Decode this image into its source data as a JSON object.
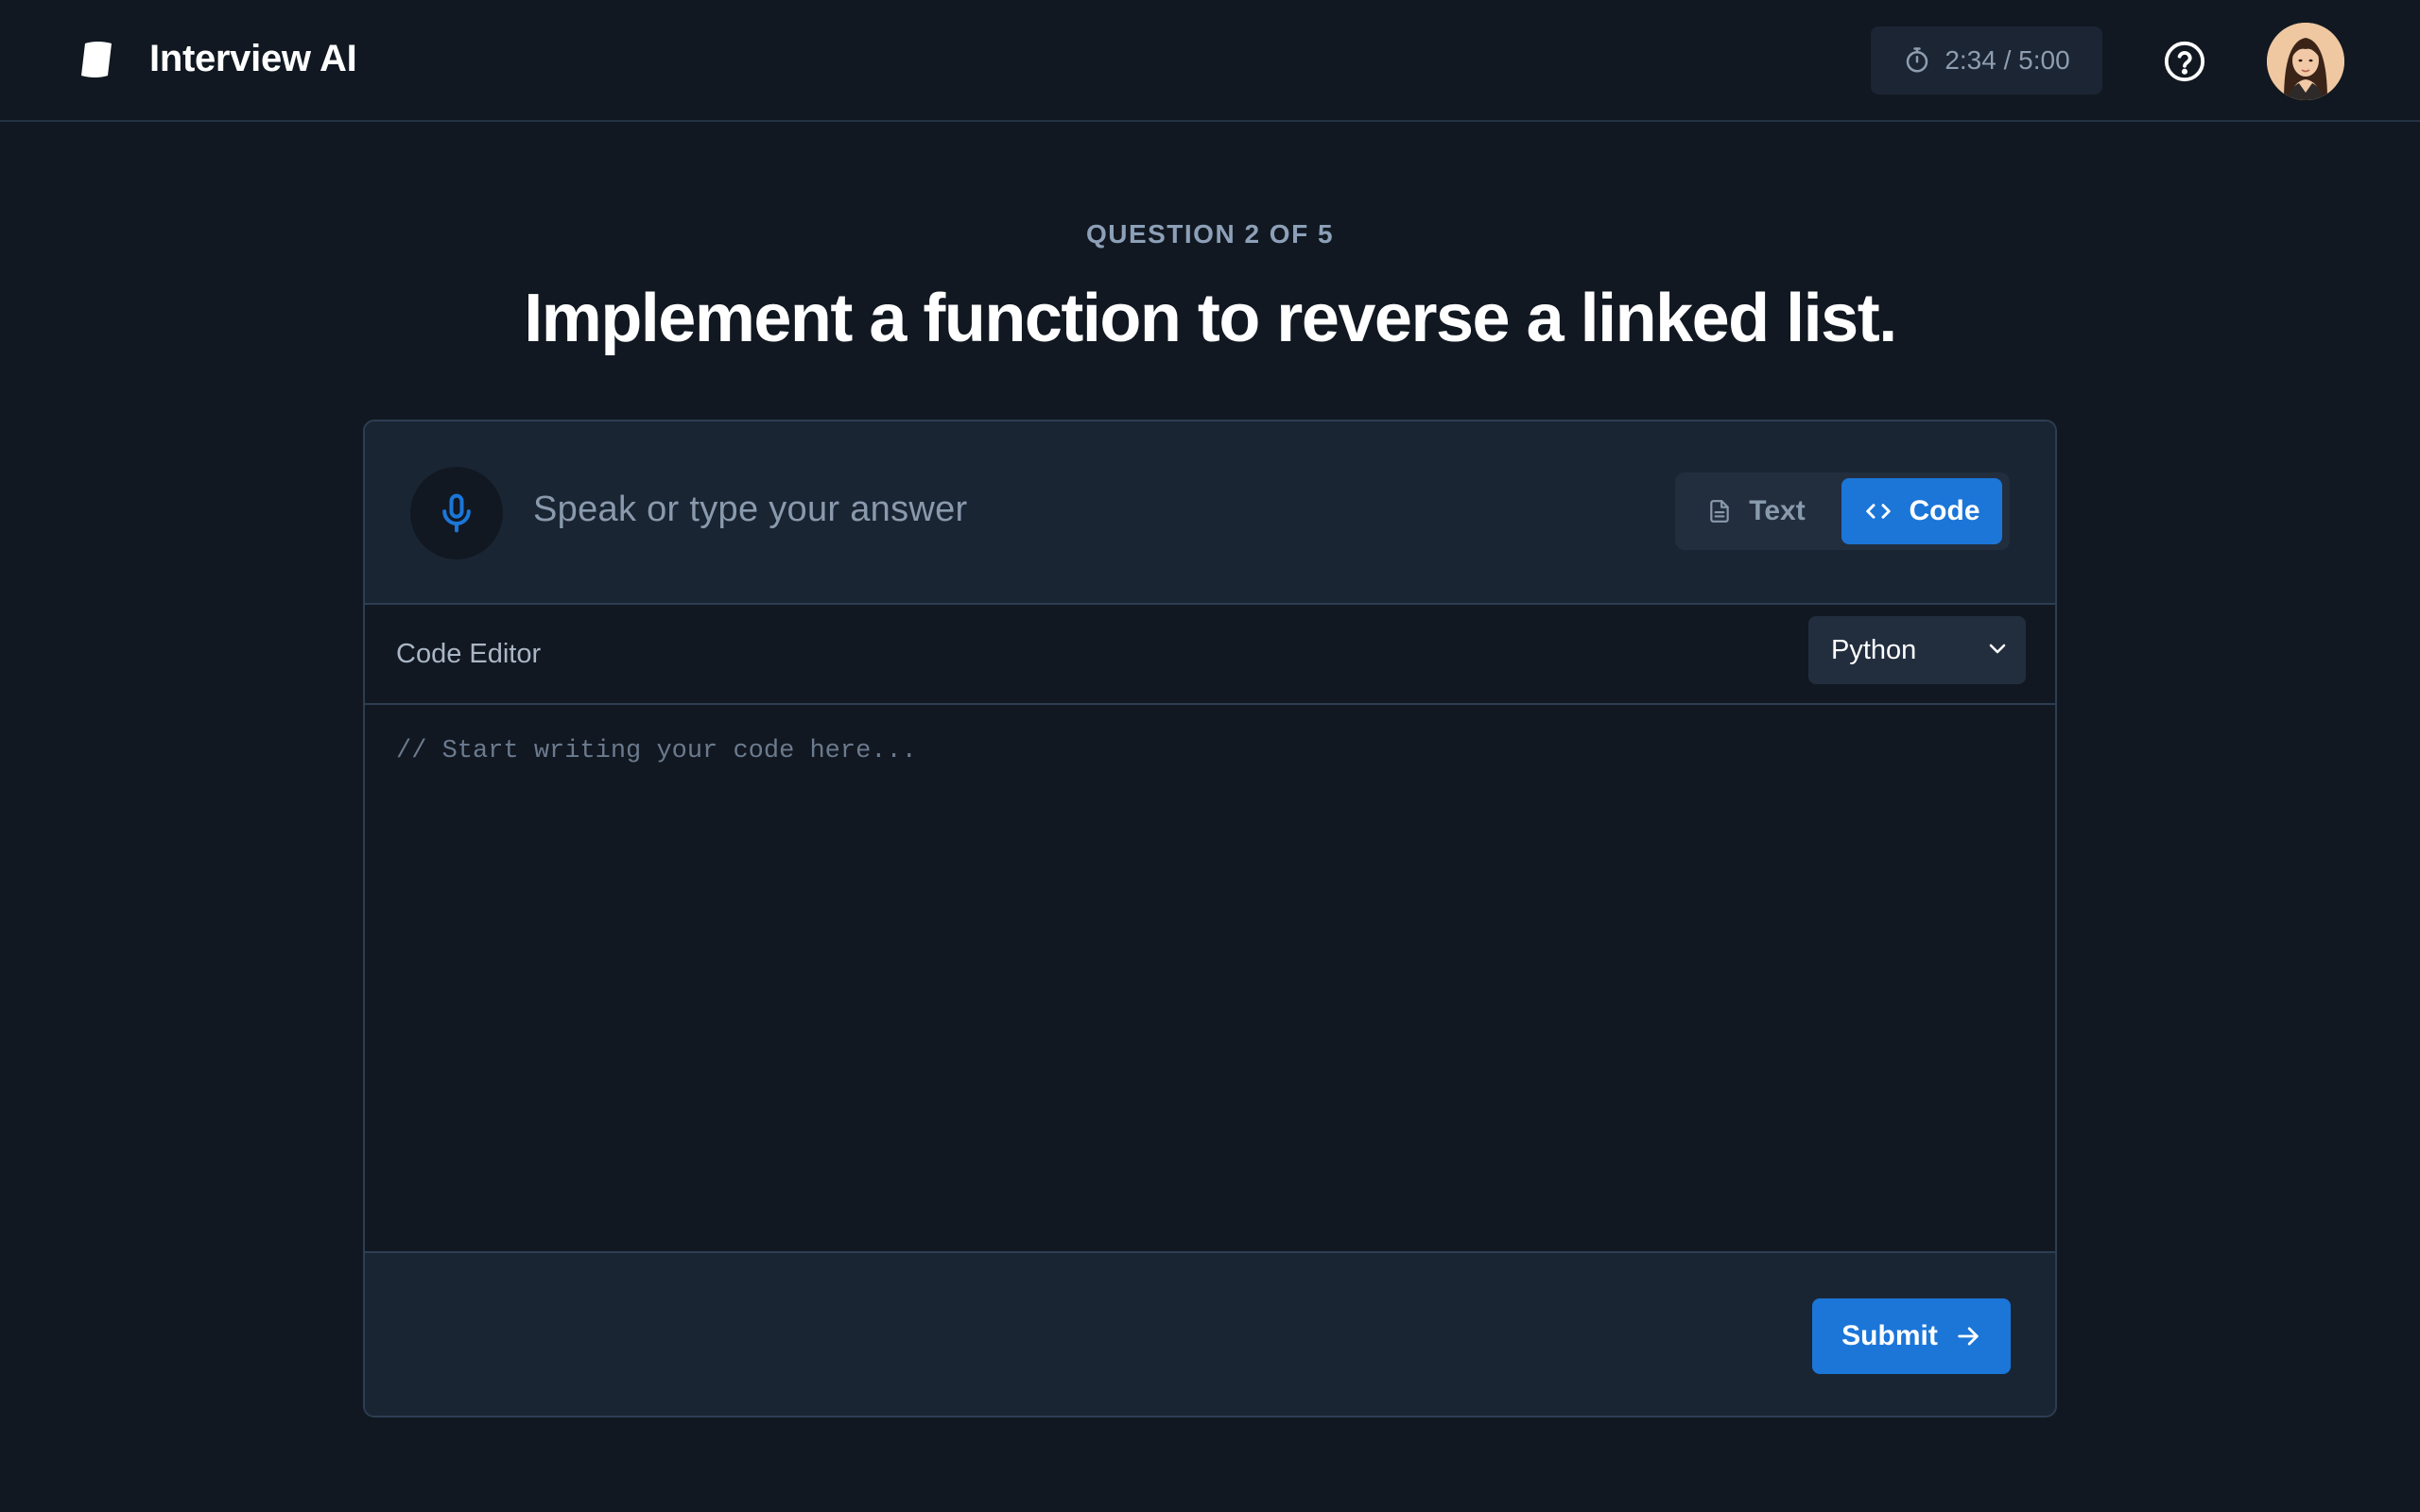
{
  "header": {
    "app_name": "Interview AI",
    "timer": "2:34 / 5:00",
    "icons": {
      "logo": "brand-logo-icon",
      "timer": "stopwatch-icon",
      "help": "help-circle-icon"
    }
  },
  "question": {
    "counter": "QUESTION 2 OF 5",
    "title": "Implement a function to reverse a linked list."
  },
  "answer": {
    "placeholder": "Speak or type your answer",
    "mic_icon": "microphone-icon",
    "modes": [
      {
        "label": "Text",
        "icon": "document-icon",
        "active": false
      },
      {
        "label": "Code",
        "icon": "code-icon",
        "active": true
      }
    ]
  },
  "editor": {
    "label": "Code Editor",
    "language": "Python",
    "placeholder": "// Start writing your code here..."
  },
  "footer": {
    "submit_label": "Submit",
    "submit_icon": "arrow-right-icon"
  },
  "colors": {
    "background": "#111821",
    "panel": "#1a2534",
    "accent": "#1b76d8",
    "muted_text": "#8a9aad"
  }
}
